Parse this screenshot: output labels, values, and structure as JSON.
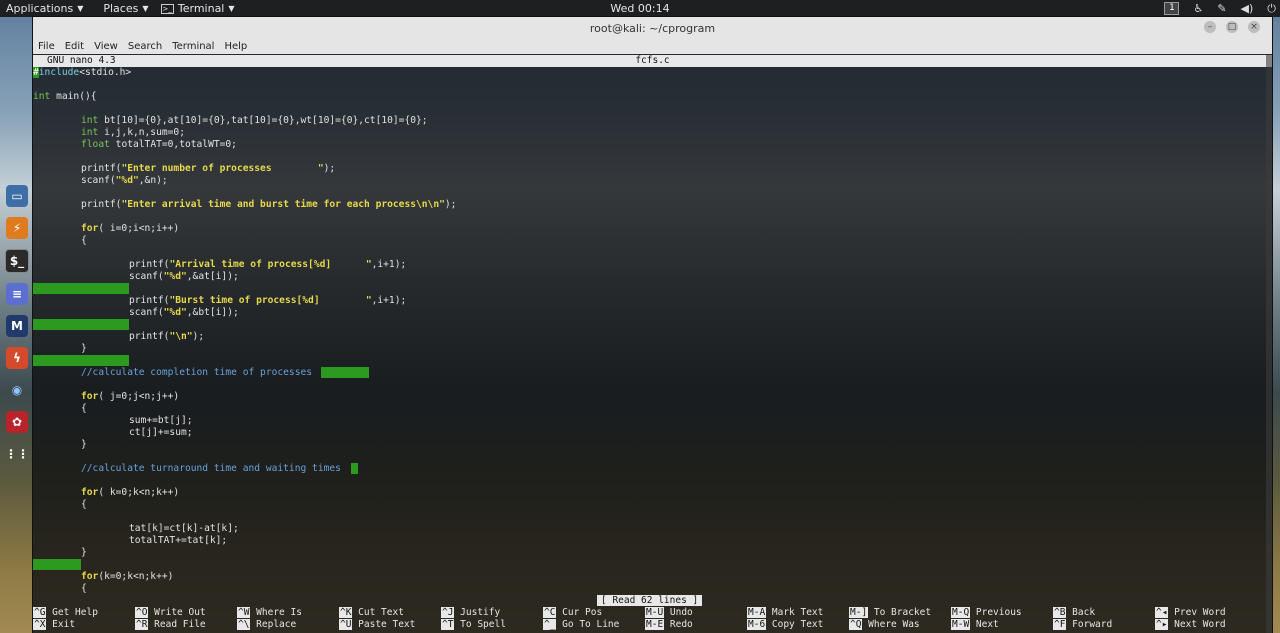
{
  "top_panel": {
    "applications": "Applications",
    "places": "Places",
    "terminal": "Terminal",
    "clock": "Wed 00:14",
    "workspace": "1",
    "icons": [
      "accessibility-icon",
      "tools-icon",
      "volume-icon",
      "power-icon"
    ]
  },
  "dock": {
    "items": [
      "files-icon",
      "burpsuite-icon",
      "terminal-icon",
      "notes-icon",
      "metasploit-icon",
      "armitage-icon",
      "eye-icon",
      "cherrytree-icon",
      "app-grid-icon"
    ]
  },
  "window": {
    "title": "root@kali: ~/cprogram",
    "menu": [
      "File",
      "Edit",
      "View",
      "Search",
      "Terminal",
      "Help"
    ]
  },
  "nano": {
    "version": "GNU nano 4.3",
    "filename": "fcfs.c",
    "status": "[ Read 62 lines ]"
  },
  "code": {
    "l1a": "#",
    "l1b": "include",
    "l1c": "<stdio.h>",
    "l3a": "int",
    "l3b": " main(){",
    "l5a": "int",
    "l5b": " bt[10]={0},at[10]={0},tat[10]={0},wt[10]={0},ct[10]={0};",
    "l6a": "int",
    "l6b": " i,j,k,n,sum=0;",
    "l7a": "float",
    "l7b": " totalTAT=0,totalWT=0;",
    "l9a": "printf(",
    "l9b": "\"Enter number of processes        \"",
    "l9c": ");",
    "l10a": "scanf(",
    "l10b": "\"%d\"",
    "l10c": ",&n);",
    "l12a": "printf(",
    "l12b": "\"Enter arrival time and burst time for each process\\n\\n\"",
    "l12c": ");",
    "l14a": "for",
    "l14b": "( i=0;i<n;i++)",
    "l15": "{",
    "l17a": "printf(",
    "l17b": "\"Arrival time of process[%d]      \"",
    "l17c": ",i+1);",
    "l18a": "scanf(",
    "l18b": "\"%d\"",
    "l18c": ",&at[i]);",
    "l20a": "printf(",
    "l20b": "\"Burst time of process[%d]        \"",
    "l20c": ",i+1);",
    "l21a": "scanf(",
    "l21b": "\"%d\"",
    "l21c": ",&bt[i]);",
    "l23a": "printf(",
    "l23b": "\"\\n\"",
    "l23c": ");",
    "l24": "}",
    "l25": "//calculate completion time of processes",
    "l27a": "for",
    "l27b": "( j=0;j<n;j++)",
    "l28": "{",
    "l29": "sum+=bt[j];",
    "l30": "ct[j]+=sum;",
    "l31": "}",
    "l33": "//calculate turnaround time and waiting times",
    "l35a": "for",
    "l35b": "( k=0;k<n;k++)",
    "l36": "{",
    "l37": "tat[k]=ct[k]-at[k];",
    "l38": "totalTAT+=tat[k];",
    "l39": "}",
    "l42a": "for",
    "l42b": "(k=0;k<n;k++)",
    "l43": "{"
  },
  "shortcuts": [
    {
      "key": "^G",
      "label": "Get Help"
    },
    {
      "key": "^X",
      "label": "Exit"
    },
    {
      "key": "^O",
      "label": "Write Out"
    },
    {
      "key": "^R",
      "label": "Read File"
    },
    {
      "key": "^W",
      "label": "Where Is"
    },
    {
      "key": "^\\",
      "label": "Replace"
    },
    {
      "key": "^K",
      "label": "Cut Text"
    },
    {
      "key": "^U",
      "label": "Paste Text"
    },
    {
      "key": "^J",
      "label": "Justify"
    },
    {
      "key": "^T",
      "label": "To Spell"
    },
    {
      "key": "^C",
      "label": "Cur Pos"
    },
    {
      "key": "^_",
      "label": "Go To Line"
    },
    {
      "key": "M-U",
      "label": "Undo"
    },
    {
      "key": "M-E",
      "label": "Redo"
    },
    {
      "key": "M-A",
      "label": "Mark Text"
    },
    {
      "key": "M-6",
      "label": "Copy Text"
    },
    {
      "key": "M-]",
      "label": "To Bracket"
    },
    {
      "key": "^Q",
      "label": "Where Was"
    },
    {
      "key": "M-Q",
      "label": "Previous"
    },
    {
      "key": "M-W",
      "label": "Next"
    },
    {
      "key": "^B",
      "label": "Back"
    },
    {
      "key": "^F",
      "label": "Forward"
    },
    {
      "key": "^◂",
      "label": "Prev Word"
    },
    {
      "key": "^▸",
      "label": "Next Word"
    }
  ],
  "colors": {
    "keyword": "#7ad0e0",
    "type": "#79c25a",
    "string": "#e8d84a",
    "comment": "#6aa0d8",
    "whitespace_highlight": "#2b9a1e"
  }
}
